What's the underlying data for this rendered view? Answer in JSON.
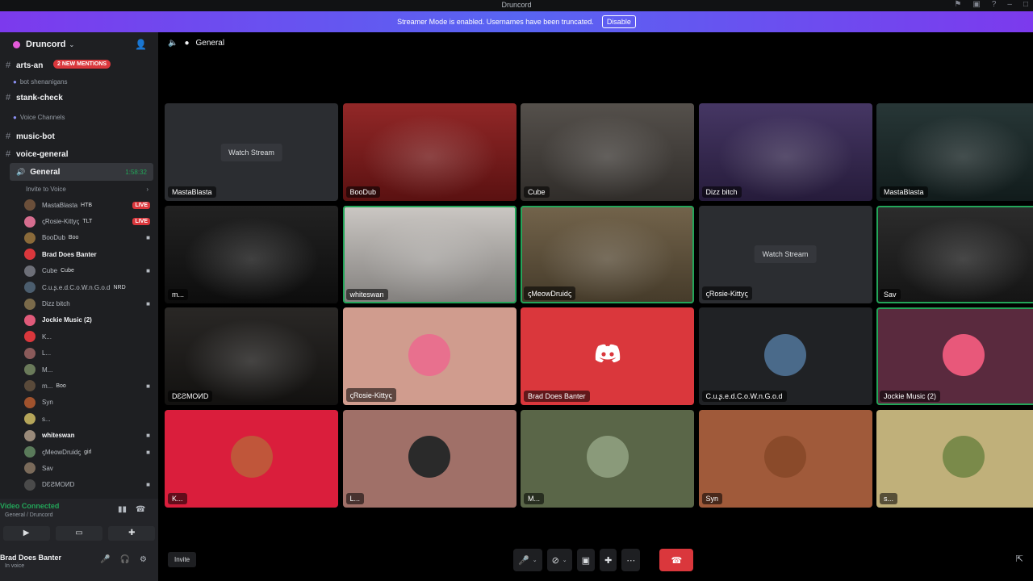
{
  "window": {
    "title": "Druncord"
  },
  "banner": {
    "text": "Streamer Mode is enabled. Usernames have been truncated.",
    "button": "Disable"
  },
  "server": {
    "name": "Druncord"
  },
  "channels": {
    "top": [
      {
        "name": "arts-an",
        "mentions": "2 NEW MENTIONS"
      }
    ],
    "category1": "bot shenanigans",
    "stank": "stank-check",
    "category2": "Voice Channels",
    "voice": [
      {
        "name": "music-bot"
      },
      {
        "name": "voice-general"
      }
    ],
    "active": {
      "name": "General",
      "timer": "1:58:32"
    },
    "invite": "Invite to Voice"
  },
  "members": [
    {
      "name": "MastaBlasta",
      "tag": "HTB",
      "bold": false,
      "live": "LIVE",
      "cam": false,
      "color": "#6b4f3a"
    },
    {
      "name": "ꞔRosie-Kittyꞔ",
      "tag": "TLT",
      "bold": false,
      "live": "LIVE",
      "cam": false,
      "color": "#d66d8f"
    },
    {
      "name": "BooDub",
      "tag": "Boo",
      "bold": false,
      "live": "",
      "cam": true,
      "color": "#8a6a3a"
    },
    {
      "name": "Brad Does Banter",
      "tag": "",
      "bold": true,
      "live": "",
      "cam": false,
      "color": "#da373c"
    },
    {
      "name": "Cube",
      "tag": "Cube",
      "bold": false,
      "live": "",
      "cam": true,
      "color": "#6d6f78"
    },
    {
      "name": "C.u.ʂ.e.d.C.o.W.n.G.o.d",
      "tag": "NRD",
      "bold": false,
      "live": "",
      "cam": false,
      "color": "#4b5d6e"
    },
    {
      "name": "Dizz bitch",
      "tag": "",
      "bold": false,
      "live": "",
      "cam": true,
      "color": "#7a6a4a"
    },
    {
      "name": "Jockie Music (2)",
      "tag": "",
      "bold": true,
      "live": "",
      "cam": false,
      "color": "#e05a7a"
    },
    {
      "name": "K...",
      "tag": "",
      "bold": false,
      "live": "",
      "cam": false,
      "color": "#da373c"
    },
    {
      "name": "L...",
      "tag": "",
      "bold": false,
      "live": "",
      "cam": false,
      "color": "#8a5a5a"
    },
    {
      "name": "M...",
      "tag": "",
      "bold": false,
      "live": "",
      "cam": false,
      "color": "#6a7a5a"
    },
    {
      "name": "m...",
      "tag": "Boo",
      "bold": false,
      "live": "",
      "cam": true,
      "color": "#5a4a3a"
    },
    {
      "name": "Syn",
      "tag": "",
      "bold": false,
      "live": "",
      "cam": false,
      "color": "#a0522d"
    },
    {
      "name": "s...",
      "tag": "",
      "bold": false,
      "live": "",
      "cam": false,
      "color": "#b5a55a"
    },
    {
      "name": "whiteswan",
      "tag": "",
      "bold": true,
      "live": "",
      "cam": true,
      "color": "#9a8a7a"
    },
    {
      "name": "ꞔMeowDruidꞔ",
      "tag": "girl",
      "bold": false,
      "live": "",
      "cam": true,
      "color": "#5a7a5a"
    },
    {
      "name": "Sav",
      "tag": "",
      "bold": false,
      "live": "",
      "cam": false,
      "color": "#7a6a5a"
    },
    {
      "name": "DƐƧMOИD",
      "tag": "",
      "bold": false,
      "live": "",
      "cam": true,
      "color": "#4a4a4a"
    }
  ],
  "panel": {
    "status": "Video Connected",
    "sub": "General / Druncord",
    "user": "Brad Does Banter",
    "user_status": "In voice"
  },
  "stage": {
    "channel": "General"
  },
  "tiles": [
    {
      "name": "MastaBlasta",
      "watch": "Watch Stream",
      "bg": "#2b2d31",
      "speaking": false,
      "kind": "stream"
    },
    {
      "name": "BooDub",
      "watch": "",
      "bg": "#8b1a1a",
      "speaking": false,
      "kind": "video"
    },
    {
      "name": "Cube",
      "watch": "",
      "bg": "#4a4540",
      "speaking": false,
      "kind": "video"
    },
    {
      "name": "Dizz bitch",
      "watch": "",
      "bg": "#3a2a5a",
      "speaking": false,
      "kind": "video"
    },
    {
      "name": "MastaBlasta",
      "watch": "",
      "bg": "#1a2a2a",
      "speaking": false,
      "kind": "video"
    },
    {
      "name": "m...",
      "watch": "",
      "bg": "#141414",
      "speaking": false,
      "kind": "video"
    },
    {
      "name": "whiteswan",
      "watch": "",
      "bg": "#c8c4c0",
      "speaking": true,
      "kind": "video"
    },
    {
      "name": "ꞔMeowDruidꞔ",
      "watch": "",
      "bg": "#6a5a40",
      "speaking": true,
      "kind": "video"
    },
    {
      "name": "ꞔRosie-Kittyꞔ",
      "watch": "Watch Stream",
      "bg": "#2b2d31",
      "speaking": false,
      "kind": "stream"
    },
    {
      "name": "Sav",
      "watch": "",
      "bg": "#1f1f1f",
      "speaking": true,
      "kind": "video"
    },
    {
      "name": "DƐƧMOИD",
      "watch": "",
      "bg": "#1c1a18",
      "speaking": false,
      "kind": "video"
    },
    {
      "name": "ꞔRosie-Kittyꞔ",
      "watch": "",
      "bg": "#d09c8e",
      "speaking": false,
      "kind": "avatar",
      "avatar": "#e8708e"
    },
    {
      "name": "Brad Does Banter",
      "watch": "",
      "bg": "#da373c",
      "speaking": false,
      "kind": "discord"
    },
    {
      "name": "C.u.ʂ.e.d.C.o.W.n.G.o.d",
      "watch": "",
      "bg": "#202225",
      "speaking": false,
      "kind": "avatar",
      "avatar": "#4a6a8a"
    },
    {
      "name": "Jockie Music (2)",
      "watch": "",
      "bg": "#5a2a3e",
      "speaking": true,
      "kind": "avatar",
      "avatar": "#e8587a"
    },
    {
      "name": "K...",
      "watch": "",
      "bg": "#da1e3c",
      "speaking": false,
      "kind": "avatar",
      "avatar": "#c0563a"
    },
    {
      "name": "L...",
      "watch": "",
      "bg": "#a07068",
      "speaking": false,
      "kind": "avatar",
      "avatar": "#2a2a2a"
    },
    {
      "name": "M...",
      "watch": "",
      "bg": "#5a6648",
      "speaking": false,
      "kind": "avatar",
      "avatar": "#8a9a7a"
    },
    {
      "name": "Syn",
      "watch": "",
      "bg": "#a05a3a",
      "speaking": false,
      "kind": "avatar",
      "avatar": "#8a4a2a"
    },
    {
      "name": "s...",
      "watch": "",
      "bg": "#c0b07a",
      "speaking": false,
      "kind": "avatar",
      "avatar": "#7a8a4a"
    }
  ],
  "bottom": {
    "invite": "Invite"
  }
}
